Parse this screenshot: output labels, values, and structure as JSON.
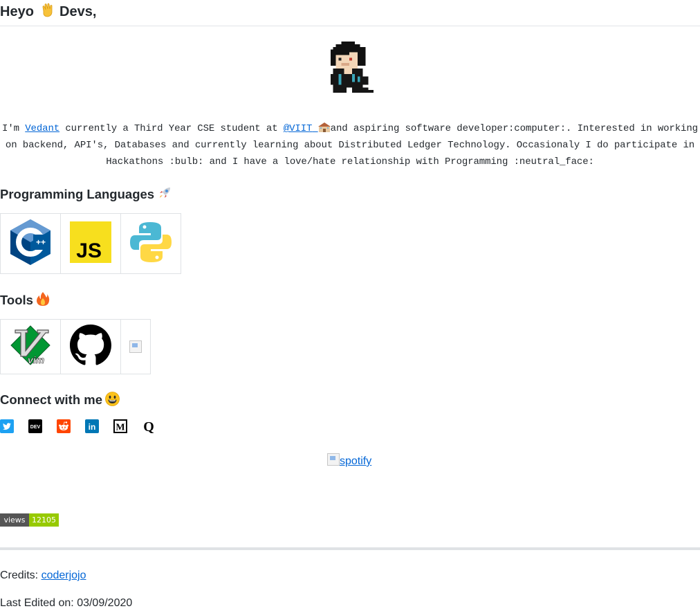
{
  "header": {
    "greeting": "Heyo",
    "greeting_tail": "Devs,"
  },
  "bio": {
    "intro": "I'm ",
    "name_link": "Vedant",
    "part2": " currently a Third Year CSE student at ",
    "school_link": "@VIIT",
    "part3": "and aspiring software developer:computer:. Interested in working on backend, API's, Databases and currently learning about Distributed Ledger Technology. Occasionaly I do participate in Hackathons :bulb: and I have a love/hate relationship with Programming :neutral_face:"
  },
  "languages": {
    "heading": "Programming Languages",
    "items": [
      {
        "name": "cpp-logo",
        "color": "#00599c"
      },
      {
        "name": "javascript-logo",
        "text": "JS",
        "color": "#f7df1e"
      },
      {
        "name": "python-logo",
        "colors": [
          "#4bb8d4",
          "#ffd845"
        ]
      }
    ]
  },
  "tools": {
    "heading": "Tools",
    "items": [
      {
        "name": "vim-logo",
        "color": "#019733"
      },
      {
        "name": "github-logo",
        "color": "#000000"
      },
      {
        "name": "broken-image"
      }
    ]
  },
  "connect": {
    "heading": "Connect with me",
    "items": [
      {
        "name": "twitter-icon",
        "color": "#1da1f2"
      },
      {
        "name": "dev-icon",
        "text": "DEV",
        "color": "#000000"
      },
      {
        "name": "reddit-icon",
        "color": "#ff4500"
      },
      {
        "name": "linkedin-icon",
        "text": "in",
        "color": "#0077b5"
      },
      {
        "name": "medium-icon",
        "text": "M",
        "color": "#000000"
      },
      {
        "name": "quora-icon",
        "text": "Q",
        "color": "#000000"
      }
    ]
  },
  "spotify": {
    "alt": "spotify"
  },
  "views_badge": {
    "label": "views",
    "count": "12105"
  },
  "footer": {
    "credits_label": "Credits: ",
    "credits_link": "coderjojo",
    "edited": "Last Edited on: 03/09/2020"
  }
}
